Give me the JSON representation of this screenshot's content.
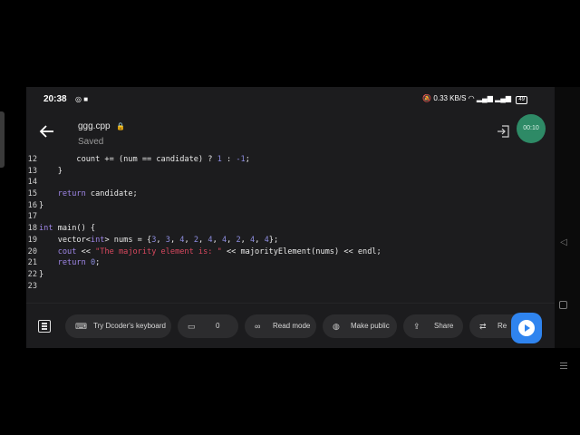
{
  "status_bar": {
    "time": "20:38",
    "left_icons": [
      "instagram-icon",
      "video-camera-icon"
    ],
    "right_text": "0.33 KB/S",
    "battery": "49"
  },
  "header": {
    "file_name": "ggg.cpp",
    "save_status": "Saved",
    "record_timer": "00:10"
  },
  "code": [
    {
      "num": "12",
      "tokens": [
        {
          "t": "        count += (num == candidate) ? "
        },
        {
          "t": "1",
          "c": "num"
        },
        {
          "t": " : "
        },
        {
          "t": "-1",
          "c": "num"
        },
        {
          "t": ";"
        }
      ]
    },
    {
      "num": "13",
      "tokens": [
        {
          "t": "    }"
        }
      ]
    },
    {
      "num": "14",
      "tokens": []
    },
    {
      "num": "15",
      "tokens": [
        {
          "t": "    "
        },
        {
          "t": "return",
          "c": "kw"
        },
        {
          "t": " candidate;"
        }
      ]
    },
    {
      "num": "16",
      "tokens": [
        {
          "t": "}"
        }
      ]
    },
    {
      "num": "17",
      "tokens": []
    },
    {
      "num": "18",
      "tokens": [
        {
          "t": "int",
          "c": "kw"
        },
        {
          "t": " main() {"
        }
      ]
    },
    {
      "num": "19",
      "tokens": [
        {
          "t": "    vector<"
        },
        {
          "t": "int",
          "c": "kw"
        },
        {
          "t": "> nums = {"
        },
        {
          "t": "3",
          "c": "num"
        },
        {
          "t": ", "
        },
        {
          "t": "3",
          "c": "num"
        },
        {
          "t": ", "
        },
        {
          "t": "4",
          "c": "num"
        },
        {
          "t": ", "
        },
        {
          "t": "2",
          "c": "num"
        },
        {
          "t": ", "
        },
        {
          "t": "4",
          "c": "num"
        },
        {
          "t": ", "
        },
        {
          "t": "4",
          "c": "num"
        },
        {
          "t": ", "
        },
        {
          "t": "2",
          "c": "num"
        },
        {
          "t": ", "
        },
        {
          "t": "4",
          "c": "num"
        },
        {
          "t": ", "
        },
        {
          "t": "4",
          "c": "num"
        },
        {
          "t": "};"
        }
      ]
    },
    {
      "num": "20",
      "tokens": [
        {
          "t": "    "
        },
        {
          "t": "cout",
          "c": "kw"
        },
        {
          "t": " << "
        },
        {
          "t": "\"The majority element is: \"",
          "c": "str"
        },
        {
          "t": " << majorityElement(nums) << endl;"
        }
      ]
    },
    {
      "num": "21",
      "tokens": [
        {
          "t": "    "
        },
        {
          "t": "return",
          "c": "kw"
        },
        {
          "t": " "
        },
        {
          "t": "0",
          "c": "num"
        },
        {
          "t": ";"
        }
      ]
    },
    {
      "num": "22",
      "tokens": [
        {
          "t": "}"
        }
      ]
    },
    {
      "num": "23",
      "tokens": []
    }
  ],
  "toolbar": {
    "keyboard_label": "Try Dcoder's keyboard",
    "comments_count": "0",
    "read_mode_label": "Read mode",
    "make_public_label": "Make public",
    "share_label": "Share",
    "rename_label": "Re"
  },
  "colors": {
    "background": "#1c1c1e",
    "keyword": "#9f86e8",
    "string": "#d9485f",
    "number": "#8d8de0",
    "run_button": "#2f84ef",
    "record": "#2e8a66"
  }
}
